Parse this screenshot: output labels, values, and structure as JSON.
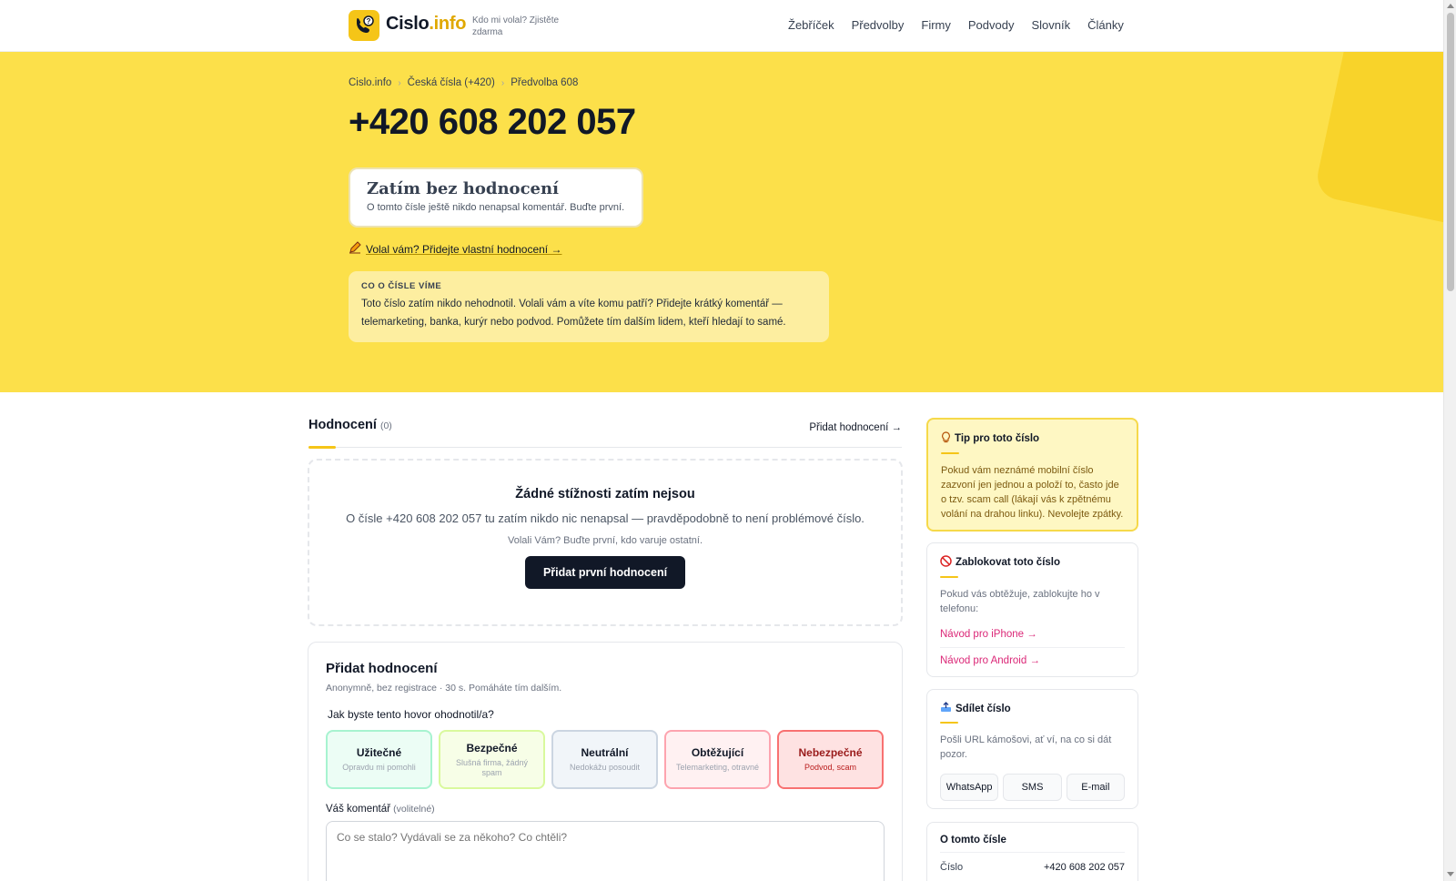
{
  "header": {
    "logo_main": "Cislo",
    "logo_accent": ".info",
    "tagline": "Kdo mi volal? Zjistěte zdarma",
    "nav": [
      "Žebříček",
      "Předvolby",
      "Firmy",
      "Podvody",
      "Slovník",
      "Články"
    ]
  },
  "hero": {
    "breadcrumb": [
      "Cislo.info",
      "Česká čísla (+420)",
      "Předvolba 608"
    ],
    "phone": "+420 608 202 057",
    "rating_title": "Zatím bez hodnocení",
    "rating_sub": "O tomto čísle ještě nikdo nenapsal komentář. Buďte první.",
    "add_link": "Volal vám? Přidejte vlastní hodnocení →",
    "info_label": "CO O ČÍSLE VÍME",
    "info_text": "Toto číslo zatím nikdo nehodnotil. Volali vám a víte komu patří? Přidejte krátký komentář — telemarketing, banka, kurýr nebo podvod. Pomůžete tím dalším lidem, kteří hledají to samé."
  },
  "reviews": {
    "title": "Hodnocení",
    "count": "(0)",
    "add": "Přidat hodnocení →",
    "empty_title": "Žádné stížnosti zatím nejsou",
    "empty_text": "O čísle +420 608 202 057 tu zatím nikdo nic nenapsal — pravděpodobně to není problémové číslo.",
    "empty_small": "Volali Vám? Buďte první, kdo varuje ostatní.",
    "empty_button": "Přidat první hodnocení"
  },
  "form": {
    "title": "Přidat hodnocení",
    "sub": "Anonymně, bez registrace · 30 s. Pomáháte tím dalším.",
    "question": "Jak byste tento hovor ohodnotil/a?",
    "options": [
      {
        "title": "Užitečné",
        "desc": "Opravdu mi pomohli"
      },
      {
        "title": "Bezpečné",
        "desc": "Slušná firma, žádný spam"
      },
      {
        "title": "Neutrální",
        "desc": "Nedokážu posoudit"
      },
      {
        "title": "Obtěžující",
        "desc": "Telemarketing, otravné"
      },
      {
        "title": "Nebezpečné",
        "desc": "Podvod, scam"
      }
    ],
    "comment_label": "Váš komentář",
    "comment_optional": "(volitelné)",
    "comment_placeholder": "Co se stalo? Vydávali se za někoho? Co chtěli?"
  },
  "sidebar": {
    "tip_title": "Tip pro toto číslo",
    "tip_text": "Pokud vám neznámé mobilní číslo zazvoní jen jednou a položí to, často jde o tzv. scam call (lákají vás k zpětnému volání na drahou linku). Nevolejte zpátky.",
    "block_title": "Zablokovat toto číslo",
    "block_text": "Pokud vás obtěžuje, zablokujte ho v telefonu:",
    "block_iphone": "Návod pro iPhone →",
    "block_android": "Návod pro Android →",
    "share_title": "Sdílet číslo",
    "share_text": "Pošli URL kámošovi, ať ví, na co si dát pozor.",
    "share_buttons": [
      "WhatsApp",
      "SMS",
      "E-mail"
    ],
    "about_title": "O tomto čísle",
    "about_label": "Číslo",
    "about_value": "+420 608 202 057"
  }
}
